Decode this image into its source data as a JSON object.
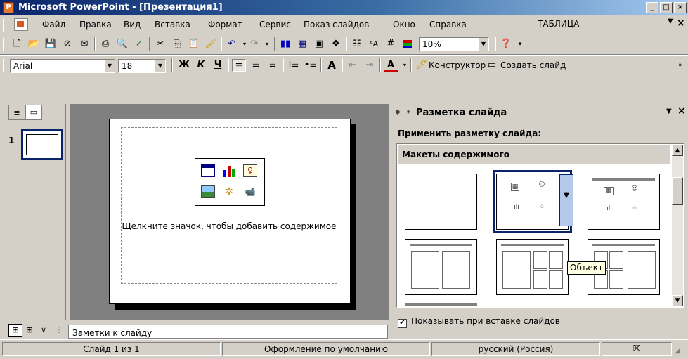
{
  "window": {
    "title": "Microsoft PowerPoint - [Презентация1]",
    "buttons": [
      "_",
      "□",
      "×"
    ]
  },
  "menu": {
    "items": [
      "Файл",
      "Правка",
      "Вид",
      "Вставка",
      "Формат",
      "Сервис",
      "Показ слайдов",
      "Окно",
      "Справка"
    ],
    "ask_box": "ТАБЛИЦА",
    "close_glyph": "×"
  },
  "standard_toolbar": {
    "zoom": "10%"
  },
  "format_toolbar": {
    "font": "Arial",
    "size": "18",
    "designer_label": "Конструктор",
    "new_slide_label": "Создать слайд"
  },
  "slides_panel": {
    "thumb_number": "1"
  },
  "slide": {
    "hint": "Щелкните значок, чтобы добавить содержимое"
  },
  "notes": {
    "placeholder": "Заметки к слайду"
  },
  "task_pane": {
    "title": "Разметка слайда",
    "apply_label": "Применить разметку слайда:",
    "section": "Макеты содержимого",
    "tooltip": "Объект",
    "checkbox_label": "Показывать при вставке слайдов",
    "checkbox_checked": true
  },
  "status": {
    "slide": "Слайд 1 из 1",
    "design": "Оформление по умолчанию",
    "language": "русский (Россия)"
  }
}
